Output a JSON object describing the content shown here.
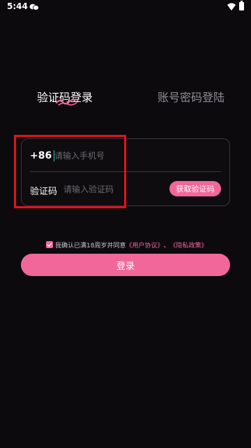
{
  "status_bar": {
    "time": "5:44"
  },
  "tabs": {
    "sms_login": "验证码登录",
    "password_login": "账号密码登陆"
  },
  "form": {
    "phone_prefix": "+86",
    "phone_placeholder": "请输入手机号",
    "code_label": "验证码",
    "code_placeholder": "请输入验证码",
    "get_code_label": "获取验证码"
  },
  "agreement": {
    "text": "我确认已满18周岁并同意",
    "user_agreement": "《用户协议》",
    "separator": "、",
    "privacy_policy": "《隐私政策》"
  },
  "login_label": "登录",
  "colors": {
    "accent": "#f2679a",
    "background": "#0c0a0d",
    "highlight": "#e3121c",
    "cursor": "#2ec7b4"
  }
}
